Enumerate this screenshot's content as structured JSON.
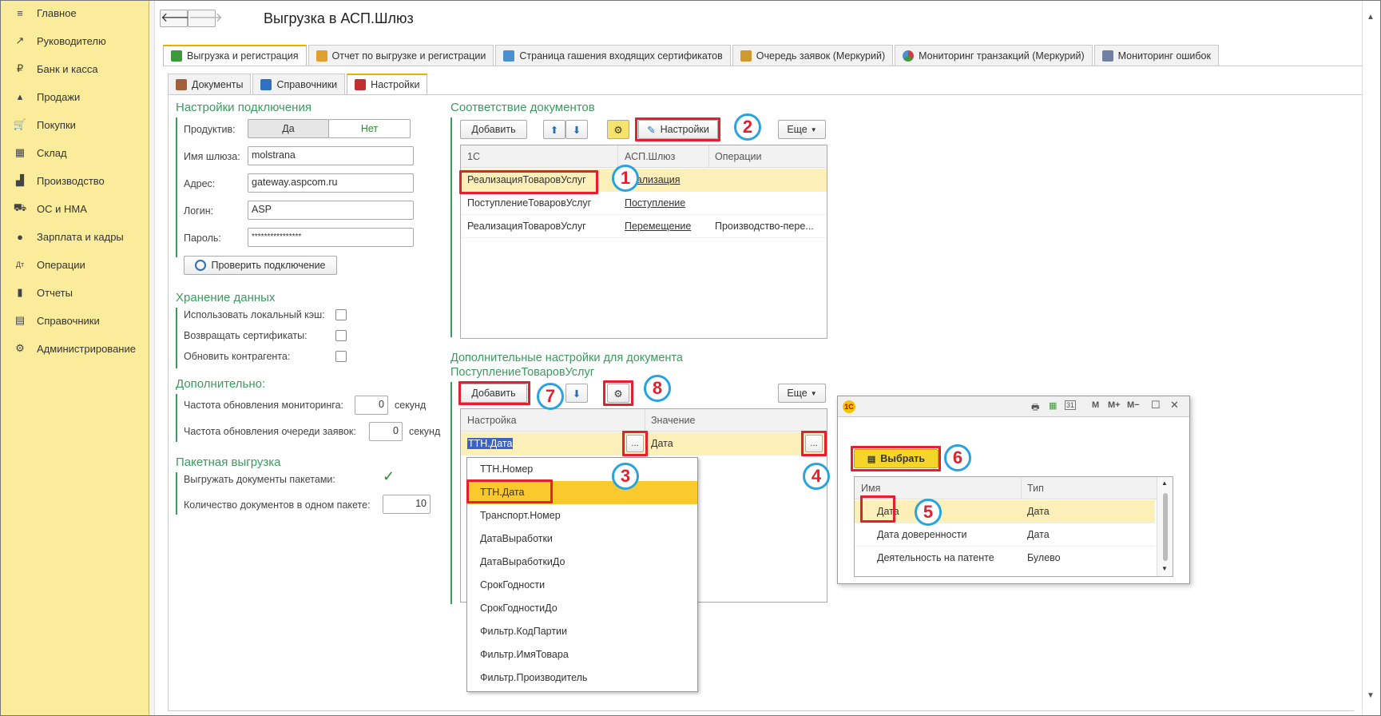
{
  "window": {
    "title": "Выгрузка в АСП.Шлюз",
    "nav_back": "🡐",
    "nav_forward": "🡒"
  },
  "sidebar": {
    "items": [
      {
        "label": "Главное",
        "icon": "≡"
      },
      {
        "label": "Руководителю",
        "icon": "↗"
      },
      {
        "label": "Банк и касса",
        "icon": "₽"
      },
      {
        "label": "Продажи",
        "icon": "▴"
      },
      {
        "label": "Покупки",
        "icon": "🛒"
      },
      {
        "label": "Склад",
        "icon": "▦"
      },
      {
        "label": "Производство",
        "icon": "▟"
      },
      {
        "label": "ОС и НМА",
        "icon": "⛟"
      },
      {
        "label": "Зарплата и кадры",
        "icon": "●"
      },
      {
        "label": "Операции",
        "icon": "Дт"
      },
      {
        "label": "Отчеты",
        "icon": "▮"
      },
      {
        "label": "Справочники",
        "icon": "▤"
      },
      {
        "label": "Администрирование",
        "icon": "⚙"
      }
    ]
  },
  "tabs": {
    "top": [
      {
        "label": "Выгрузка и регистрация",
        "color": "#3c9a3c"
      },
      {
        "label": "Отчет по выгрузке и регистрации",
        "color": "#e0a030"
      },
      {
        "label": "Страница гашения входящих сертификатов",
        "color": "#4a8fd0"
      },
      {
        "label": "Очередь заявок (Меркурий)",
        "color": "#d09a30"
      },
      {
        "label": "Мониторинг транзакций (Меркурий)",
        "color": "#d04040"
      },
      {
        "label": "Мониторинг ошибок",
        "color": "#7080a0"
      }
    ],
    "second": [
      {
        "label": "Документы",
        "color": "#a0603a"
      },
      {
        "label": "Справочники",
        "color": "#3070c0"
      },
      {
        "label": "Настройки",
        "color": "#c03030"
      }
    ]
  },
  "connection": {
    "title": "Настройки подключения",
    "productive_label": "Продуктив:",
    "yes": "Да",
    "no": "Нет",
    "gateway_label": "Имя шлюза:",
    "gateway": "molstrana",
    "address_label": "Адрес:",
    "address": "gateway.aspcom.ru",
    "login_label": "Логин:",
    "login": "ASP",
    "password_label": "Пароль:",
    "password": "****************",
    "check_button": "Проверить подключение"
  },
  "storage": {
    "title": "Хранение данных",
    "local_cache": "Использовать локальный кэш:",
    "return_certs": "Возвращать сертификаты:",
    "update_contractor": "Обновить контрагента:"
  },
  "additional": {
    "title": "Дополнительно:",
    "monitor_freq": "Частота обновления мониторинга:",
    "monitor_value": "0",
    "monitor_unit": "секунд",
    "queue_freq": "Частота обновления очереди заявок:",
    "queue_value": "0",
    "queue_unit": "секунд"
  },
  "batch": {
    "title": "Пакетная выгрузка",
    "export_batches": "Выгружать документы пакетами:",
    "count_label": "Количество документов в одном пакете:",
    "count_value": "10"
  },
  "mapping": {
    "title": "Соответствие документов",
    "add": "Добавить",
    "settings": "Настройки",
    "more": "Еще",
    "columns": [
      "1С",
      "АСП.Шлюз",
      "Операции"
    ],
    "rows": [
      [
        "РеализацияТоваровУслуг",
        "Реализация",
        ""
      ],
      [
        "ПоступлениеТоваровУслуг",
        "Поступление",
        ""
      ],
      [
        "РеализацияТоваровУслуг",
        "Перемещение",
        "Производство-пере..."
      ]
    ]
  },
  "doc_settings": {
    "title_line1": "Дополнительные настройки для документа",
    "title_line2": "ПоступлениеТоваровУслуг",
    "add": "Добавить",
    "more": "Еще",
    "columns": [
      "Настройка",
      "Значение"
    ],
    "row": {
      "setting": "ТТН.Дата",
      "value": "Дата"
    },
    "ellipsis": "..."
  },
  "dropdown": {
    "items": [
      "ТТН.Номер",
      "ТТН.Дата",
      "Транспорт.Номер",
      "ДатаВыработки",
      "ДатаВыработкиДо",
      "СрокГодности",
      "СрокГодностиДо",
      "Фильтр.КодПартии",
      "Фильтр.ИмяТовара",
      "Фильтр.Производитель"
    ]
  },
  "chooser": {
    "logo": "1С",
    "toolbar": [
      "🖶",
      "▦",
      "31",
      "M",
      "M+",
      "M−",
      "☐",
      "✕"
    ],
    "select": "Выбрать",
    "columns": [
      "Имя",
      "Тип"
    ],
    "rows": [
      [
        "Дата",
        "Дата"
      ],
      [
        "Дата доверенности",
        "Дата"
      ],
      [
        "Деятельность на патенте",
        "Булево"
      ]
    ]
  },
  "callouts": [
    "1",
    "2",
    "3",
    "4",
    "5",
    "6",
    "7",
    "8"
  ],
  "colors": {
    "accent_green": "#3c9a5f",
    "highlight": "#fcefb7",
    "selected": "#f9c92e",
    "callout_red": "#e4202e",
    "callout_blue": "#29a3df",
    "sidebar": "#fbec9b"
  }
}
